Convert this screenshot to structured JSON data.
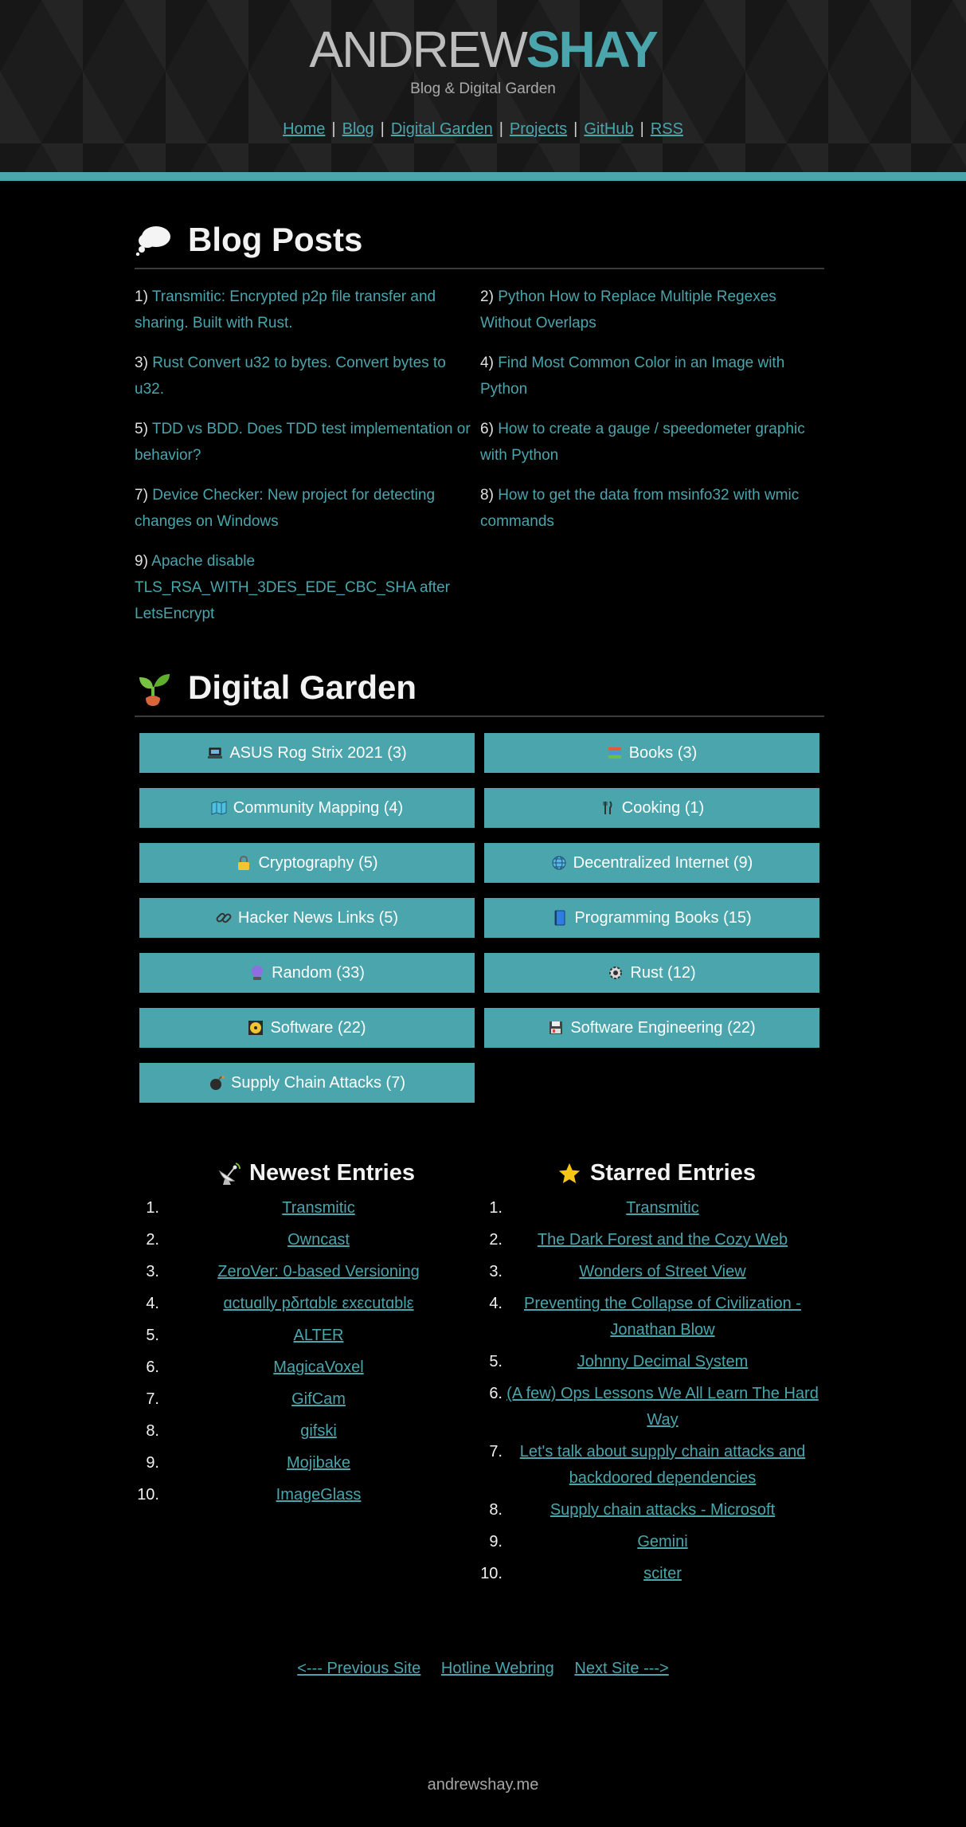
{
  "site": {
    "logo_first": "ANDREW",
    "logo_last": "SHAY",
    "tagline": "Blog & Digital Garden",
    "nav": [
      "Home",
      "Blog",
      "Digital Garden",
      "Projects",
      "GitHub",
      "RSS"
    ],
    "accent_color": "#4aa5ac"
  },
  "blog": {
    "title": "Blog Posts",
    "icon": "thought-balloon-icon",
    "posts": [
      {
        "num": "1)",
        "title": "Transmitic: Encrypted p2p file transfer and sharing. Built with Rust."
      },
      {
        "num": "2)",
        "title": "Python How to Replace Multiple Regexes Without Overlaps"
      },
      {
        "num": "3)",
        "title": "Rust Convert u32 to bytes. Convert bytes to u32."
      },
      {
        "num": "4)",
        "title": "Find Most Common Color in an Image with Python"
      },
      {
        "num": "5)",
        "title": "TDD vs BDD. Does TDD test implementation or behavior?"
      },
      {
        "num": "6)",
        "title": "How to create a gauge / speedometer graphic with Python"
      },
      {
        "num": "7)",
        "title": "Device Checker: New project for detecting changes on Windows"
      },
      {
        "num": "8)",
        "title": "How to get the data from msinfo32 with wmic commands"
      },
      {
        "num": "9)",
        "title": "Apache disable TLS_RSA_WITH_3DES_EDE_CBC_SHA after LetsEncrypt"
      }
    ]
  },
  "garden": {
    "title": "Digital Garden",
    "icon": "seedling-icon",
    "categories": [
      {
        "label": "ASUS Rog Strix 2021 (3)",
        "icon": "laptop-icon"
      },
      {
        "label": "Books (3)",
        "icon": "books-icon"
      },
      {
        "label": "Community Mapping (4)",
        "icon": "map-icon"
      },
      {
        "label": "Cooking (1)",
        "icon": "fork-knife-icon"
      },
      {
        "label": "Cryptography (5)",
        "icon": "lock-icon"
      },
      {
        "label": "Decentralized Internet (9)",
        "icon": "globe-icon"
      },
      {
        "label": "Hacker News Links (5)",
        "icon": "link-icon"
      },
      {
        "label": "Programming Books (15)",
        "icon": "blue-book-icon"
      },
      {
        "label": "Random (33)",
        "icon": "crystal-ball-icon"
      },
      {
        "label": "Rust (12)",
        "icon": "gear-icon"
      },
      {
        "label": "Software (22)",
        "icon": "cd-icon"
      },
      {
        "label": "Software Engineering (22)",
        "icon": "floppy-disk-icon"
      },
      {
        "label": "Supply Chain Attacks (7)",
        "icon": "bomb-icon"
      }
    ]
  },
  "newest": {
    "title": "Newest Entries",
    "icon": "satellite-antenna-icon",
    "items": [
      "Transmitic",
      "Owncast",
      "ZeroVer: 0-based Versioning",
      "ɑctuɑlly pδrtɑblε εxεcutɑblε",
      "ALTER",
      "MagicaVoxel",
      "GifCam",
      "gifski",
      "Mojibake",
      "ImageGlass"
    ]
  },
  "starred": {
    "title": "Starred Entries",
    "icon": "star-icon",
    "items": [
      "Transmitic",
      "The Dark Forest and the Cozy Web",
      "Wonders of Street View",
      "Preventing the Collapse of Civilization - Jonathan Blow",
      "Johnny Decimal System",
      "(A few) Ops Lessons We All Learn The Hard Way",
      "Let's talk about supply chain attacks and backdoored dependencies",
      "Supply chain attacks - Microsoft",
      "Gemini",
      "sciter"
    ]
  },
  "webring": {
    "prev": "<--- Previous Site",
    "name": "Hotline Webring",
    "next": "Next Site --->"
  },
  "footer": {
    "domain": "andrewshay.me"
  }
}
